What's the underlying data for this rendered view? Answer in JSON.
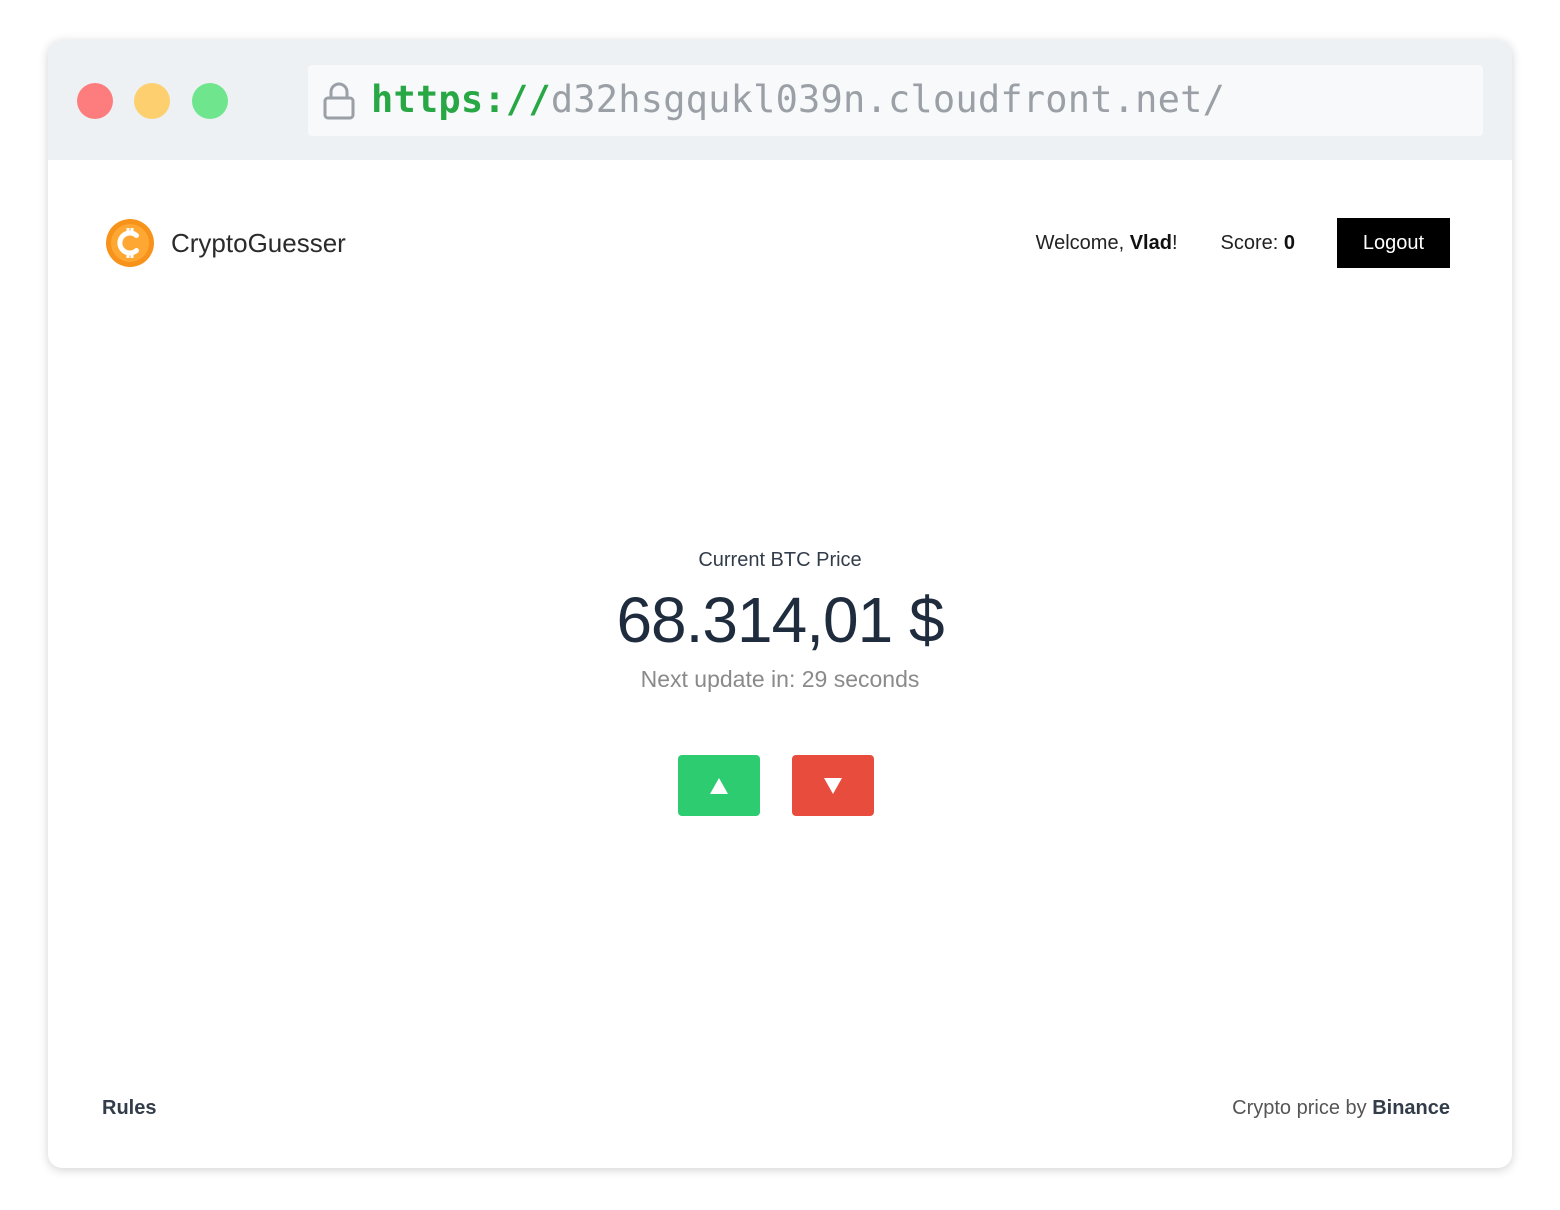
{
  "browser": {
    "url_scheme": "https://",
    "url_rest": "d32hsgqukl039n.cloudfront.net/",
    "colors": {
      "close": "#fd7d7e",
      "minimize": "#fdcf6e",
      "maximize": "#6fe58d",
      "scheme": "#28a745",
      "rest": "#9aa0a6"
    }
  },
  "header": {
    "brand_name": "CryptoGuesser",
    "brand_icon": "bitcoin-coin-icon",
    "brand_color": "#f7931a",
    "welcome_prefix": "Welcome, ",
    "user_name": "Vlad",
    "welcome_suffix": "!",
    "score_label": "Score: ",
    "score_value": "0",
    "logout_label": "Logout"
  },
  "main": {
    "price_label": "Current BTC Price",
    "price_value": "68.314,01 $",
    "next_update": "Next update in: 29 seconds",
    "up_button": {
      "symbol": "▲",
      "color": "#2dcc70"
    },
    "down_button": {
      "symbol": "▼",
      "color": "#e74c3c"
    }
  },
  "footer": {
    "rules_label": "Rules",
    "credit_prefix": "Crypto price by ",
    "credit_link": "Binance"
  }
}
